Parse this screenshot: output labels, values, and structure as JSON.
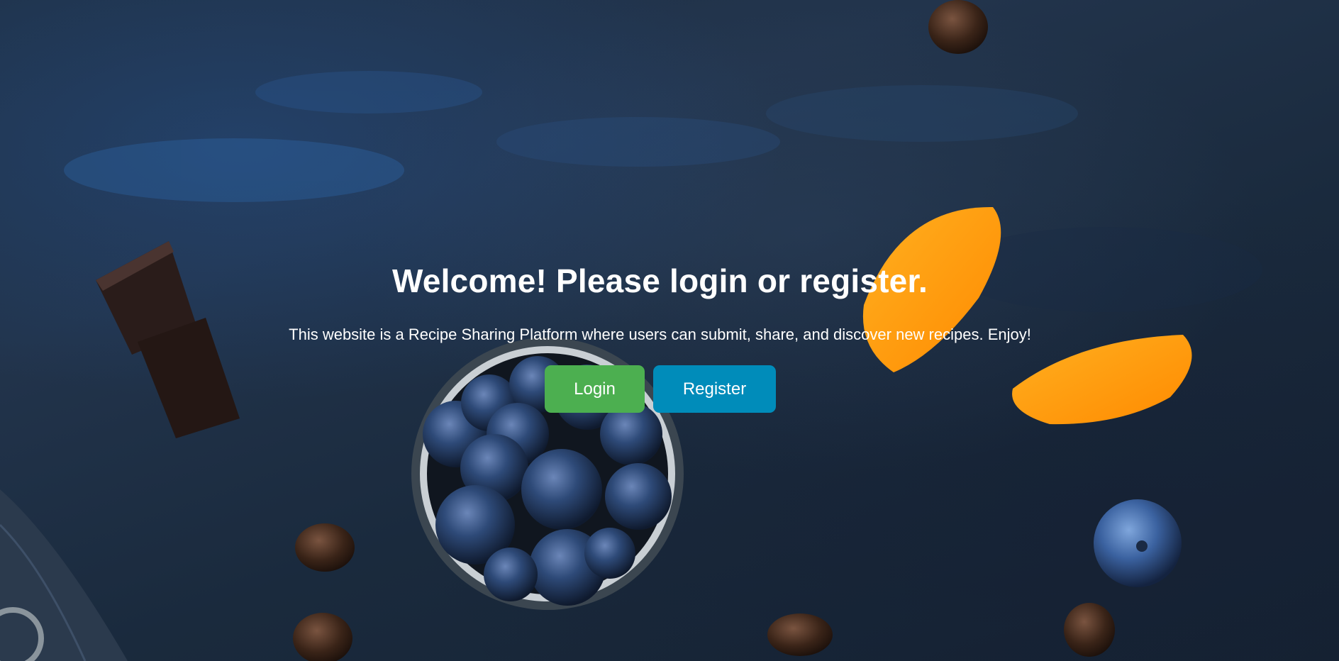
{
  "hero": {
    "title": "Welcome! Please login or register.",
    "description": "This website is a Recipe Sharing Platform where users can submit, share, and discover new recipes. Enjoy!"
  },
  "actions": {
    "login_label": "Login",
    "register_label": "Register"
  },
  "colors": {
    "login_button": "#4caf50",
    "register_button": "#008cba",
    "background": "#1f3147",
    "text": "#ffffff"
  },
  "background_image": {
    "subject": "dark blue table with blueberries in a tin, orange slices, dark chocolate, coffee beans"
  }
}
